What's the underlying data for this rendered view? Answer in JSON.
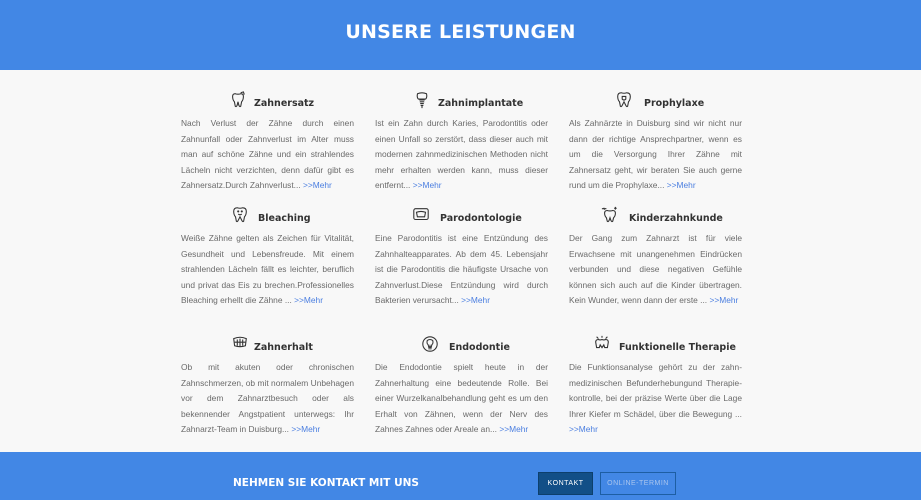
{
  "header": {
    "title": "UNSERE LEISTUNGEN"
  },
  "services": [
    {
      "icon": "crown-tooth-icon",
      "title": "Zahnersatz",
      "text": "Nach Verlust der Zähne durch einen Zahnunfall oder Zahnverlust im Alter muss man auf schöne Zähne und ein strahlendes Lächeln nicht verzichten, denn dafür gibt es Zahnersatz.Durch Zahnverlust...",
      "link": ">>Mehr"
    },
    {
      "icon": "implant-tooth-icon",
      "title": "Zahnimplantate",
      "text": "Ist ein Zahn durch Karies, Parodontitis oder einen Unfall so zerstört, dass dieser auch mit modernen zahnmedizinischen Methoden nicht mehr erhalten werden kann, muss dieser entfernt...",
      "link": ">>Mehr"
    },
    {
      "icon": "tooth-shield-icon",
      "title": "Prophylaxe",
      "text": "Als Zahnärzte in Duisburg sind wir nicht nur dann der richtige Ansprechpartner, wenn es um die Versorgung Ihrer Zähne mit Zahnersatz geht, wir beraten Sie auch gerne rund um die Prophylaxe...",
      "link": ">>Mehr"
    },
    {
      "icon": "smiling-tooth-icon",
      "title": "Bleaching",
      "text": "Weiße Zähne gelten als Zeichen für Vitalität, Gesundheit und Lebensfreude. Mit einem strahlenden Lächeln fällt es leichter, beruflich und privat das Eis zu brechen.Professionelles Bleaching erhellt die Zähne ...",
      "link": ">>Mehr"
    },
    {
      "icon": "gum-tooth-icon",
      "title": "Parodontologie",
      "text": "Eine Parodontitis ist eine Entzündung des Zahnhalteapparates. Ab dem 45. Lebensjahr ist die Parodontitis die häufigste Ursache von Zahnverlust.Diese Entzündung wird durch Bakterien verursacht...",
      "link": ">>Mehr"
    },
    {
      "icon": "sparkle-tooth-icon",
      "title": "Kinderzahnkunde",
      "text": "Der Gang zum Zahnarzt ist für viele Erwachsene mit unangenehmen Eindrücken verbunden und diese negativen Gefühle können sich auch auf die Kinder übertragen. Kein Wunder, wenn dann der erste ...",
      "link": ">>Mehr"
    },
    {
      "icon": "braces-tooth-icon",
      "title": "Zahnerhalt",
      "text": "Ob mit akuten oder chronischen Zahnschmerzen, ob mit normalem Unbehagen vor dem Zahnarztbesuch oder als bekennender Angstpatient unterwegs: Ihr Zahnarzt-Team in Duisburg...",
      "link": ">>Mehr"
    },
    {
      "icon": "root-canal-icon",
      "title": "Endodontie",
      "text": "Die Endodontie spielt heute in der Zahnerhaltung eine bedeutende Rolle. Bei einer Wurzelkanalbehandlung geht es um den Erhalt von Zähnen, wenn der Nerv des Zahnes Zahnes oder Areale an...",
      "link": ">>Mehr"
    },
    {
      "icon": "jaw-tooth-icon",
      "title": "Funktionelle Therapie",
      "text": "Die Funktionsanalyse gehört zu der zahn-medizinischen Befunderhebungund Therapie- kontrolle, bei der präzise Werte über die Lage Ihrer Kiefer m Schädel, über die Bewegung ...",
      "link": ">>Mehr"
    }
  ],
  "contact": {
    "title": "NEHMEN SIE KONTAKT MIT UNS",
    "button_contact": "KONTAKT",
    "button_appointment": "ONLINE-TERMIN"
  },
  "colors": {
    "primary": "#4287e5",
    "button_dark": "#124f87",
    "link": "#4a7ee0",
    "background": "#f8f8f8"
  }
}
